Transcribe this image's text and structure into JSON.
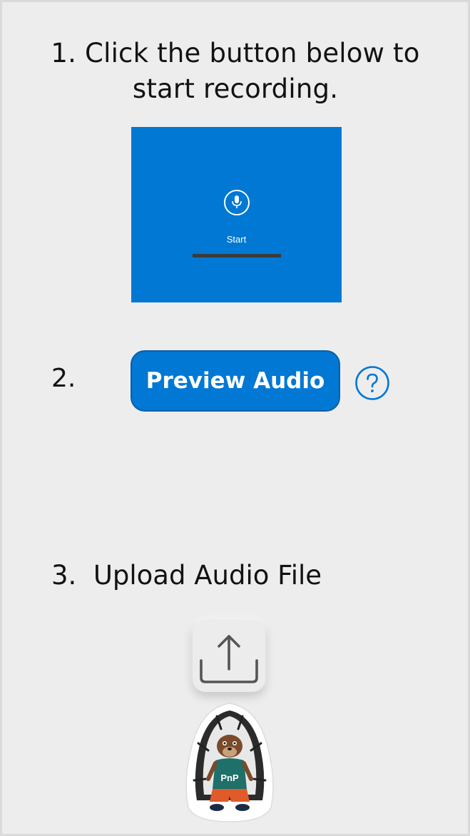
{
  "step1": {
    "text": "1. Click the button below to start recording."
  },
  "recorder": {
    "start_label": "Start",
    "icon": "microphone-icon",
    "background": "#0078d4"
  },
  "step2": {
    "number": "2.",
    "button_label": "Preview Audio",
    "help_icon": "question-circle-icon"
  },
  "step3": {
    "text": "3.  Upload Audio File",
    "upload_icon": "upload-icon"
  },
  "mascot": {
    "name": "pnp-mascot",
    "badge": "PnP"
  },
  "colors": {
    "accent": "#0078d4",
    "background": "#ededee",
    "text": "#121212"
  }
}
